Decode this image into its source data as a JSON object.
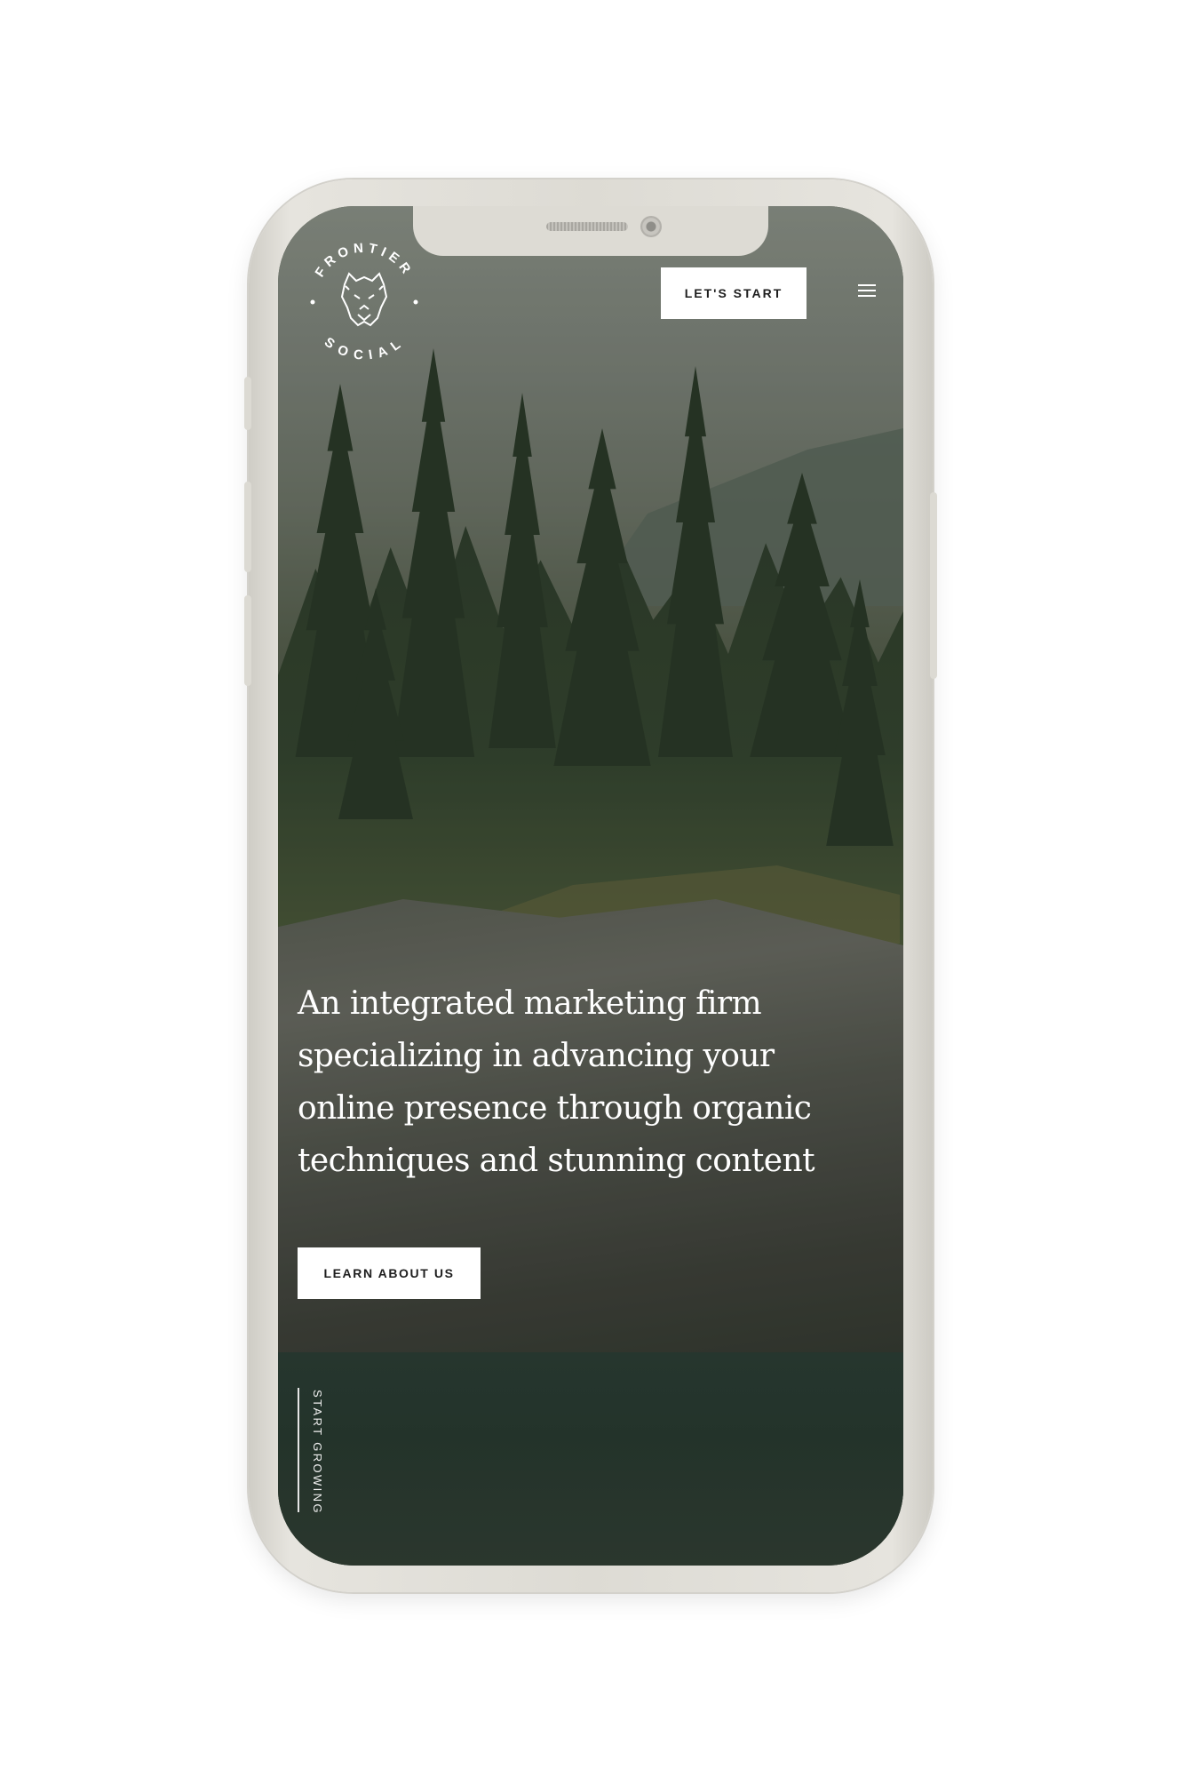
{
  "brand": {
    "logo_top_text": "FRONTIER",
    "logo_bottom_text": "SOCIAL"
  },
  "header": {
    "cta_label": "LET'S START",
    "menu_icon": "hamburger-menu-icon"
  },
  "hero": {
    "headline_lines": [
      "An integrated marketing firm",
      "specializing in advancing your",
      "online presence through organic",
      "techniques and stunning content"
    ],
    "button_label": "LEARN ABOUT US",
    "scroll_cue": "START GROWING",
    "background": "forest-river-photo"
  },
  "colors": {
    "button_bg": "#ffffff",
    "button_text": "#1e1e1e",
    "text_on_image": "#ffffff",
    "device_frame": "#dddbd4"
  }
}
